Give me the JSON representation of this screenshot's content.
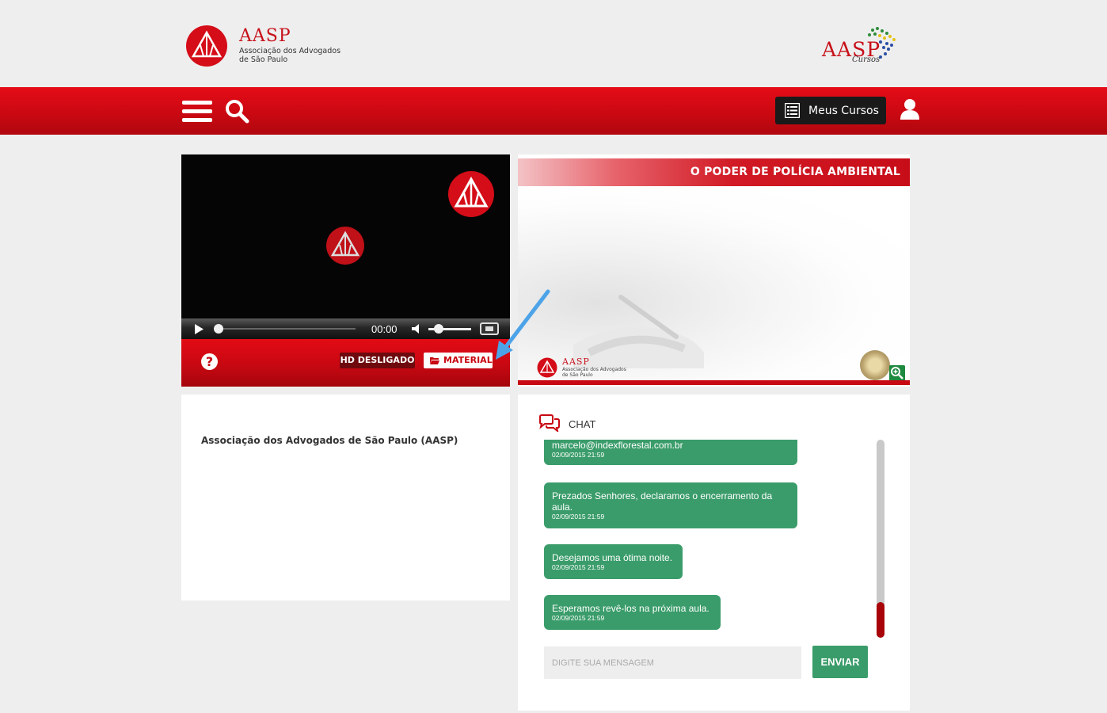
{
  "header": {
    "logo_title": "AASP",
    "logo_subtitle_1": "Associação dos Advogados",
    "logo_subtitle_2": "de São Paulo",
    "cursos_brand": "AASP",
    "cursos_label": "Cursos"
  },
  "navbar": {
    "meus_cursos_label": "Meus Cursos"
  },
  "player": {
    "time": "00:00",
    "hd_label": "HD DESLIGADO",
    "material_label": "MATERIAL",
    "help_glyph": "?"
  },
  "slide": {
    "title": "O PODER DE POLÍCIA AMBIENTAL",
    "logo_title": "AASP",
    "logo_subtitle_1": "Associação dos Advogados",
    "logo_subtitle_2": "de São Paulo"
  },
  "info": {
    "organization": "Associação dos Advogados de São Paulo (AASP)"
  },
  "chat": {
    "title": "CHAT",
    "messages": [
      {
        "text": "marcelo@indexflorestal.com.br",
        "time": "02/09/2015 21:59"
      },
      {
        "text": "Prezados Senhores, declaramos o encerramento da aula.",
        "time": "02/09/2015 21:59"
      },
      {
        "text": "Desejamos uma ótima noite.",
        "time": "02/09/2015 21:59"
      },
      {
        "text": "Esperamos revê-los na próxima aula.",
        "time": "02/09/2015 21:59"
      }
    ],
    "input_placeholder": "DIGITE SUA MENSAGEM",
    "send_label": "ENVIAR"
  },
  "colors": {
    "brand_red": "#c80812",
    "chat_green": "#3a9c6a",
    "dark_button": "#1a1a1a"
  }
}
